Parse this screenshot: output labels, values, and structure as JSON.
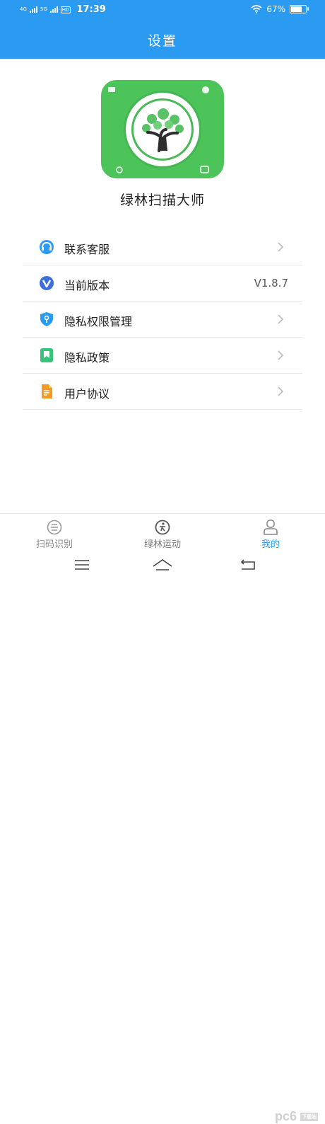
{
  "status_bar": {
    "network1": "4G",
    "network2": "5G",
    "hd": "HD",
    "time": "17:39",
    "battery": "67%",
    "battery_level": 0.67
  },
  "header": {
    "title": "设置"
  },
  "app": {
    "name": "绿林扫描大师"
  },
  "menu": {
    "items": [
      {
        "label": "联系客服",
        "icon": "headset-icon"
      },
      {
        "label": "当前版本",
        "icon": "vivo-v-icon",
        "value": "V1.8.7"
      },
      {
        "label": "隐私权限管理",
        "icon": "shield-icon"
      },
      {
        "label": "隐私政策",
        "icon": "bookmark-icon"
      },
      {
        "label": "用户协议",
        "icon": "document-icon"
      }
    ]
  },
  "tabbar": {
    "tabs": [
      {
        "label": "扫码识别",
        "icon": "scan-icon"
      },
      {
        "label": "绿林运动",
        "icon": "sport-icon"
      },
      {
        "label": "我的",
        "icon": "profile-icon",
        "active": true
      }
    ]
  },
  "watermark": {
    "text": "pc6",
    "sub": "下载站"
  },
  "colors": {
    "accent": "#2b9bf2",
    "app_green": "#4cc45a",
    "divider": "#e9e9e9"
  }
}
